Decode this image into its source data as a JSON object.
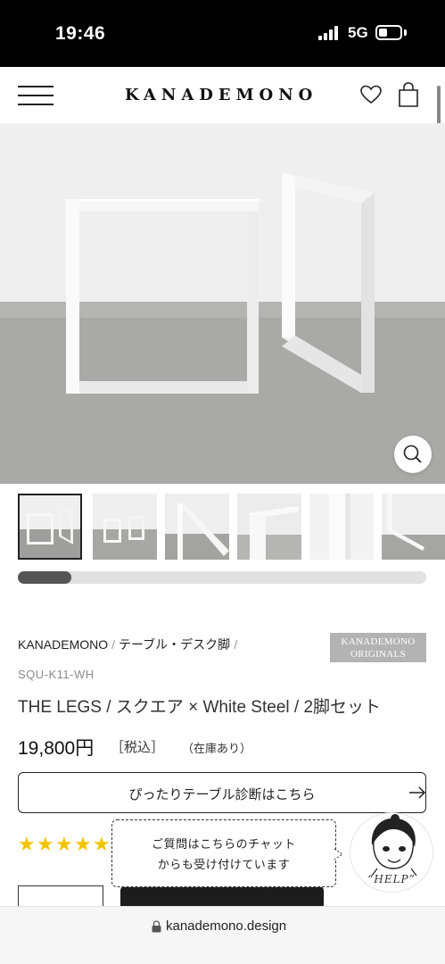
{
  "status_bar": {
    "time": "19:46",
    "network": "5G"
  },
  "header": {
    "logo": "KANADEMONO"
  },
  "icons": {
    "menu": "hamburger-icon",
    "favorite": "heart-icon",
    "cart": "shopping-bag-icon",
    "zoom": "magnifier-icon",
    "arrow": "arrow-right-icon",
    "lock": "lock-icon"
  },
  "gallery": {
    "thumbnail_count": 6,
    "active_index": 0,
    "scroll_progress": 0.13
  },
  "product": {
    "brand": "KANADEMONO",
    "category": "テーブル・デスク脚",
    "badge_line1": "KANADEMONO",
    "badge_line2": "ORIGINALS",
    "sku": "SQU-K11-WH",
    "title": "THE LEGS / スクエア × White Steel / 2脚セット",
    "price": "19,800円",
    "tax": "［税込］",
    "stock": "（在庫あり）",
    "diagnose_button": "ぴったりテーブル診断はこちら",
    "rating_stars": 5
  },
  "chat": {
    "line1": "ご質問はこちらのチャット",
    "line2": "からも受け付けています",
    "help_label": "“HELP”"
  },
  "browser": {
    "url": "kanademono.design"
  },
  "colors": {
    "star": "#f2c400",
    "badge": "#b3b3b3",
    "status_bar": "#000000",
    "cart_button": "#1c1c1c"
  }
}
